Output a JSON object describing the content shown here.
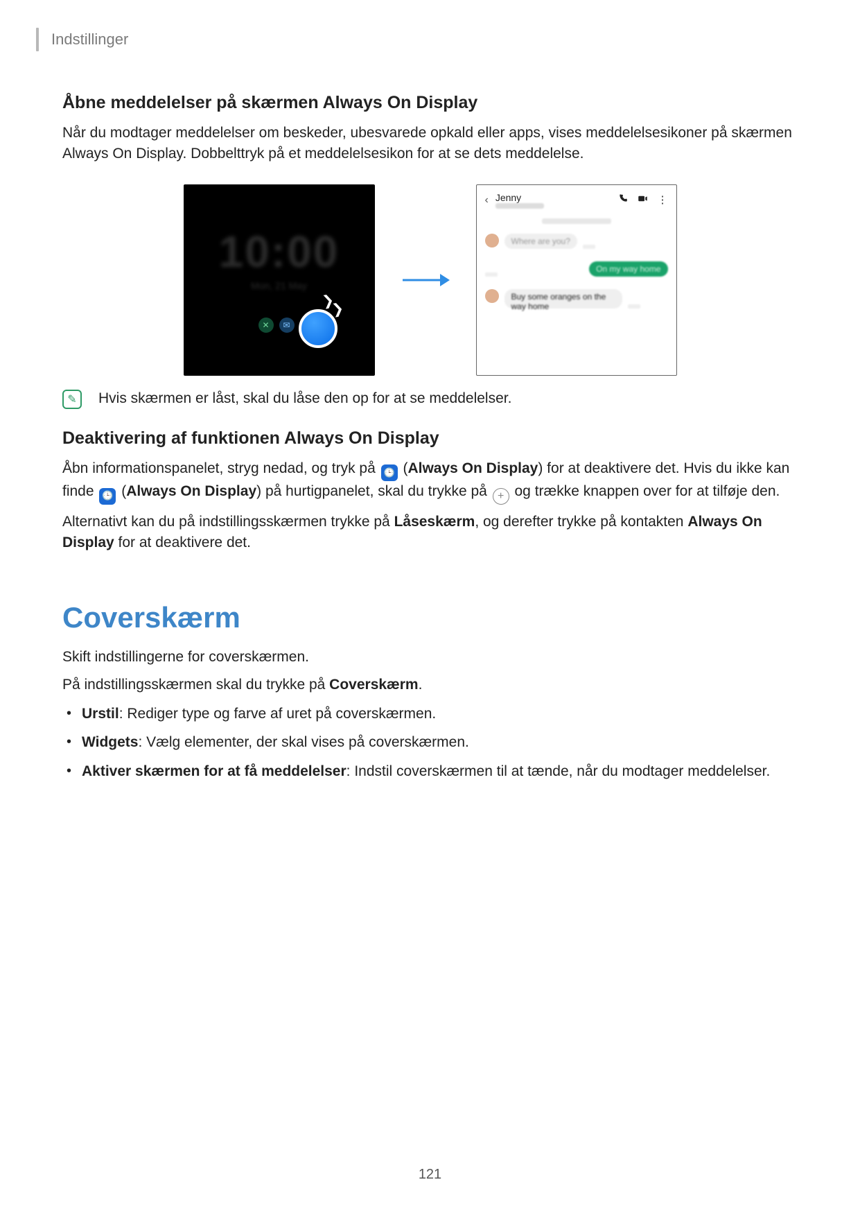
{
  "chapter": "Indstillinger",
  "sec1_title": "Åbne meddelelser på skærmen Always On Display",
  "sec1_p": "Når du modtager meddelelser om beskeder, ubesvarede opkald eller apps, vises meddelelsesikoner på skærmen Always On Display. Dobbelttryk på et meddelelsesikon for at se dets meddelelse.",
  "figure": {
    "aod_time": "10:00",
    "aod_date": "Mon, 21 May",
    "chat_name": "Jenny",
    "chat_glyphs": {
      "back": "‹",
      "phone": "📞",
      "video": "◯",
      "more": "⋮"
    },
    "msg_in1": "Where are you?",
    "msg_out": "On my way home",
    "msg_in2": "Buy some oranges on the way home"
  },
  "note": "Hvis skærmen er låst, skal du låse den op for at se meddelelser.",
  "sec2_title": "Deaktivering af funktionen Always On Display",
  "sec2_p1_a": "Åbn informationspanelet, stryg nedad, og tryk på ",
  "sec2_p1_b": " (",
  "sec2_p1_bold1": "Always On Display",
  "sec2_p1_c": ") for at deaktivere det. Hvis du ikke kan finde ",
  "sec2_p1_d": " (",
  "sec2_p1_bold2": "Always On Display",
  "sec2_p1_e": ") på hurtigpanelet, skal du trykke på ",
  "sec2_p1_f": " og trække knappen over for at tilføje den.",
  "sec2_p2_a": "Alternativt kan du på indstillingsskærmen trykke på ",
  "sec2_p2_bold1": "Låseskærm",
  "sec2_p2_b": ", og derefter trykke på kontakten ",
  "sec2_p2_bold2": "Always On Display",
  "sec2_p2_c": " for at deaktivere det.",
  "cover_title": "Coverskærm",
  "cover_p1": "Skift indstillingerne for coverskærmen.",
  "cover_p2_a": "På indstillingsskærmen skal du trykke på ",
  "cover_p2_bold": "Coverskærm",
  "cover_p2_b": ".",
  "bul1_bold": "Urstil",
  "bul1_rest": ": Rediger type og farve af uret på coverskærmen.",
  "bul2_bold": "Widgets",
  "bul2_rest": ": Vælg elementer, der skal vises på coverskærmen.",
  "bul3_bold": "Aktiver skærmen for at få meddelelser",
  "bul3_rest": ": Indstil coverskærmen til at tænde, når du modtager meddelelser.",
  "page_number": "121",
  "icon_glyphs": {
    "aod": "🕒",
    "plus": "+",
    "note": "✎"
  }
}
